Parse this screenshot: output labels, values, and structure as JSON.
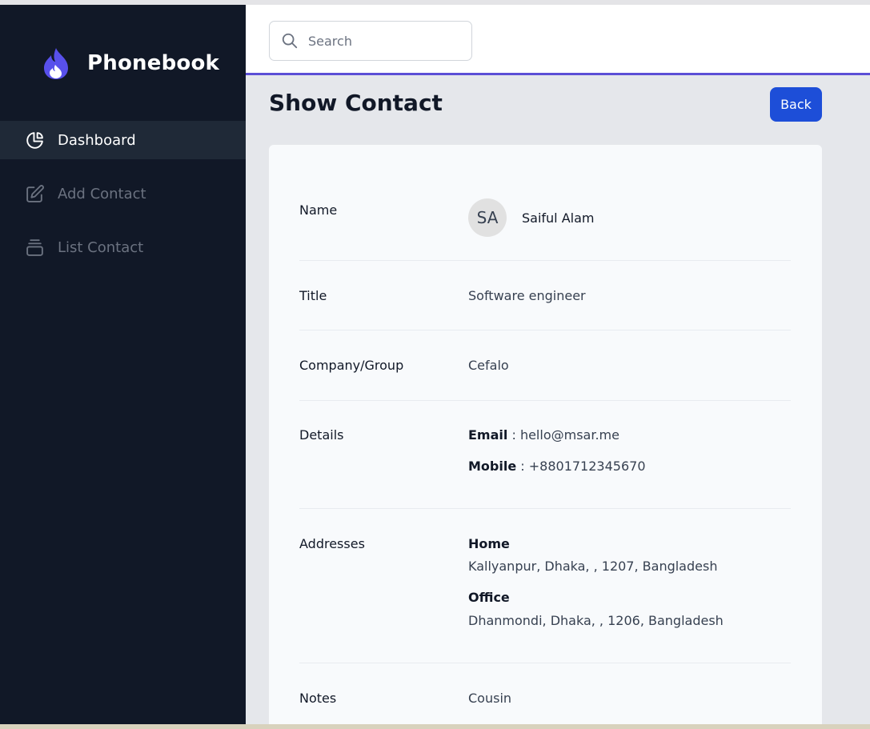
{
  "app": {
    "name": "Phonebook"
  },
  "sidebar": {
    "items": [
      {
        "label": "Dashboard",
        "icon": "chart-pie-icon",
        "active": true
      },
      {
        "label": "Add Contact",
        "icon": "edit-icon",
        "active": false
      },
      {
        "label": "List Contact",
        "icon": "archive-icon",
        "active": false
      }
    ]
  },
  "search": {
    "placeholder": "Search",
    "value": ""
  },
  "page": {
    "title": "Show Contact",
    "back_label": "Back"
  },
  "contact": {
    "labels": {
      "name": "Name",
      "title": "Title",
      "company": "Company/Group",
      "details": "Details",
      "addresses": "Addresses",
      "notes": "Notes"
    },
    "initials": "SA",
    "name": "Saiful Alam",
    "title": "Software engineer",
    "company": "Cefalo",
    "email_label": "Email",
    "email": "hello@msar.me",
    "mobile_label": "Mobile",
    "mobile": "+8801712345670",
    "addresses": [
      {
        "type": "Home",
        "text": "Kallyanpur, Dhaka, , 1207, Bangladesh"
      },
      {
        "type": "Office",
        "text": "Dhanmondi, Dhaka, , 1206, Bangladesh"
      }
    ],
    "notes": "Cousin"
  },
  "colors": {
    "sidebar_bg": "#111827",
    "accent_line": "#5b4fd6",
    "button_bg": "#1d4ed8",
    "logo": "#6366f1"
  }
}
